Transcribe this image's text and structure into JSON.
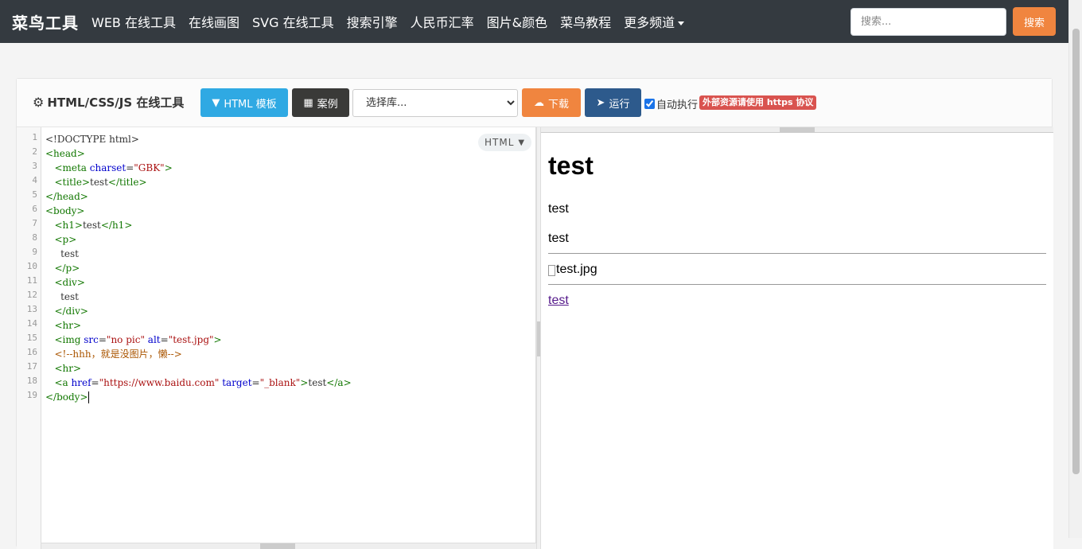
{
  "nav": {
    "brand": "菜鸟工具",
    "links": [
      "WEB 在线工具",
      "在线画图",
      "SVG 在线工具",
      "搜索引擎",
      "人民币汇率",
      "图片&颜色",
      "菜鸟教程",
      "更多频道"
    ],
    "search_placeholder": "搜索...",
    "search_button": "搜索"
  },
  "toolbar": {
    "title": "HTML/CSS/JS 在线工具",
    "template_button": "HTML 模板",
    "example_button": "案例",
    "library_select": "选择库...",
    "download_button": "下载",
    "run_button": "运行",
    "autorun_label": "自动执行",
    "autorun_checked": true,
    "https_notice": "外部资源请使用 https 协议"
  },
  "editor": {
    "language": "HTML",
    "line_numbers": [
      "1",
      "2",
      "3",
      "4",
      "5",
      "6",
      "7",
      "8",
      "9",
      "10",
      "11",
      "12",
      "13",
      "14",
      "15",
      "16",
      "17",
      "18",
      "19"
    ],
    "lines": [
      "<!DOCTYPE html>",
      "<head>",
      "   <meta charset=\"GBK\">",
      "   <title>test</title>",
      "</head>",
      "<body>",
      "   <h1>test</h1>",
      "   <p>",
      "     test",
      "   </p>",
      "   <div>",
      "     test",
      "   </div>",
      "   <hr>",
      "   <img src=\"no pic\" alt=\"test.jpg\">",
      "   <!--hhh，就是没图片，懒-->",
      "   <hr>",
      "   <a href=\"https://www.baidu.com\" target=\"_blank\">test</a>",
      "</body>"
    ]
  },
  "preview": {
    "heading": "test",
    "paragraph": "test",
    "div_text": "test",
    "image_alt": "test.jpg",
    "link_text": "test"
  },
  "colors": {
    "nav_bg": "#343a40",
    "accent_orange": "#f0853f",
    "template_blue": "#2fa9e3",
    "run_blue": "#2d5a8c",
    "badge_red": "#d9534f"
  }
}
